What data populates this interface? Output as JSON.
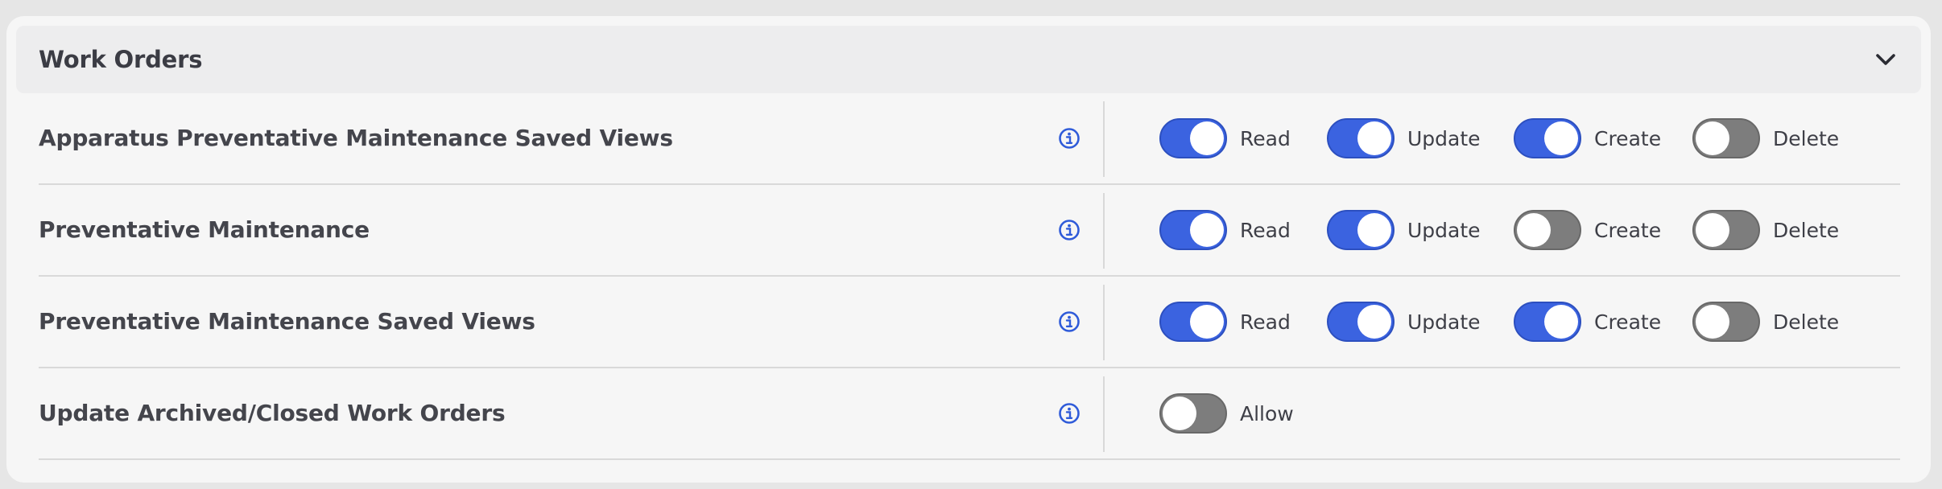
{
  "section": {
    "title": "Work Orders",
    "collapse_icon": "chevron-down-icon"
  },
  "colors": {
    "toggle_on": "#3b63e0",
    "toggle_off": "#7d7d7d",
    "info_icon": "#2f5bd9"
  },
  "rows": [
    {
      "label": "Apparatus Preventative Maintenance Saved Views",
      "permissions": [
        {
          "label": "Read",
          "enabled": true
        },
        {
          "label": "Update",
          "enabled": true
        },
        {
          "label": "Create",
          "enabled": true
        },
        {
          "label": "Delete",
          "enabled": false
        }
      ]
    },
    {
      "label": "Preventative Maintenance",
      "permissions": [
        {
          "label": "Read",
          "enabled": true
        },
        {
          "label": "Update",
          "enabled": true
        },
        {
          "label": "Create",
          "enabled": false
        },
        {
          "label": "Delete",
          "enabled": false
        }
      ]
    },
    {
      "label": "Preventative Maintenance Saved Views",
      "permissions": [
        {
          "label": "Read",
          "enabled": true
        },
        {
          "label": "Update",
          "enabled": true
        },
        {
          "label": "Create",
          "enabled": true
        },
        {
          "label": "Delete",
          "enabled": false
        }
      ]
    },
    {
      "label": "Update Archived/Closed Work Orders",
      "permissions": [
        {
          "label": "Allow",
          "enabled": false
        }
      ]
    }
  ]
}
